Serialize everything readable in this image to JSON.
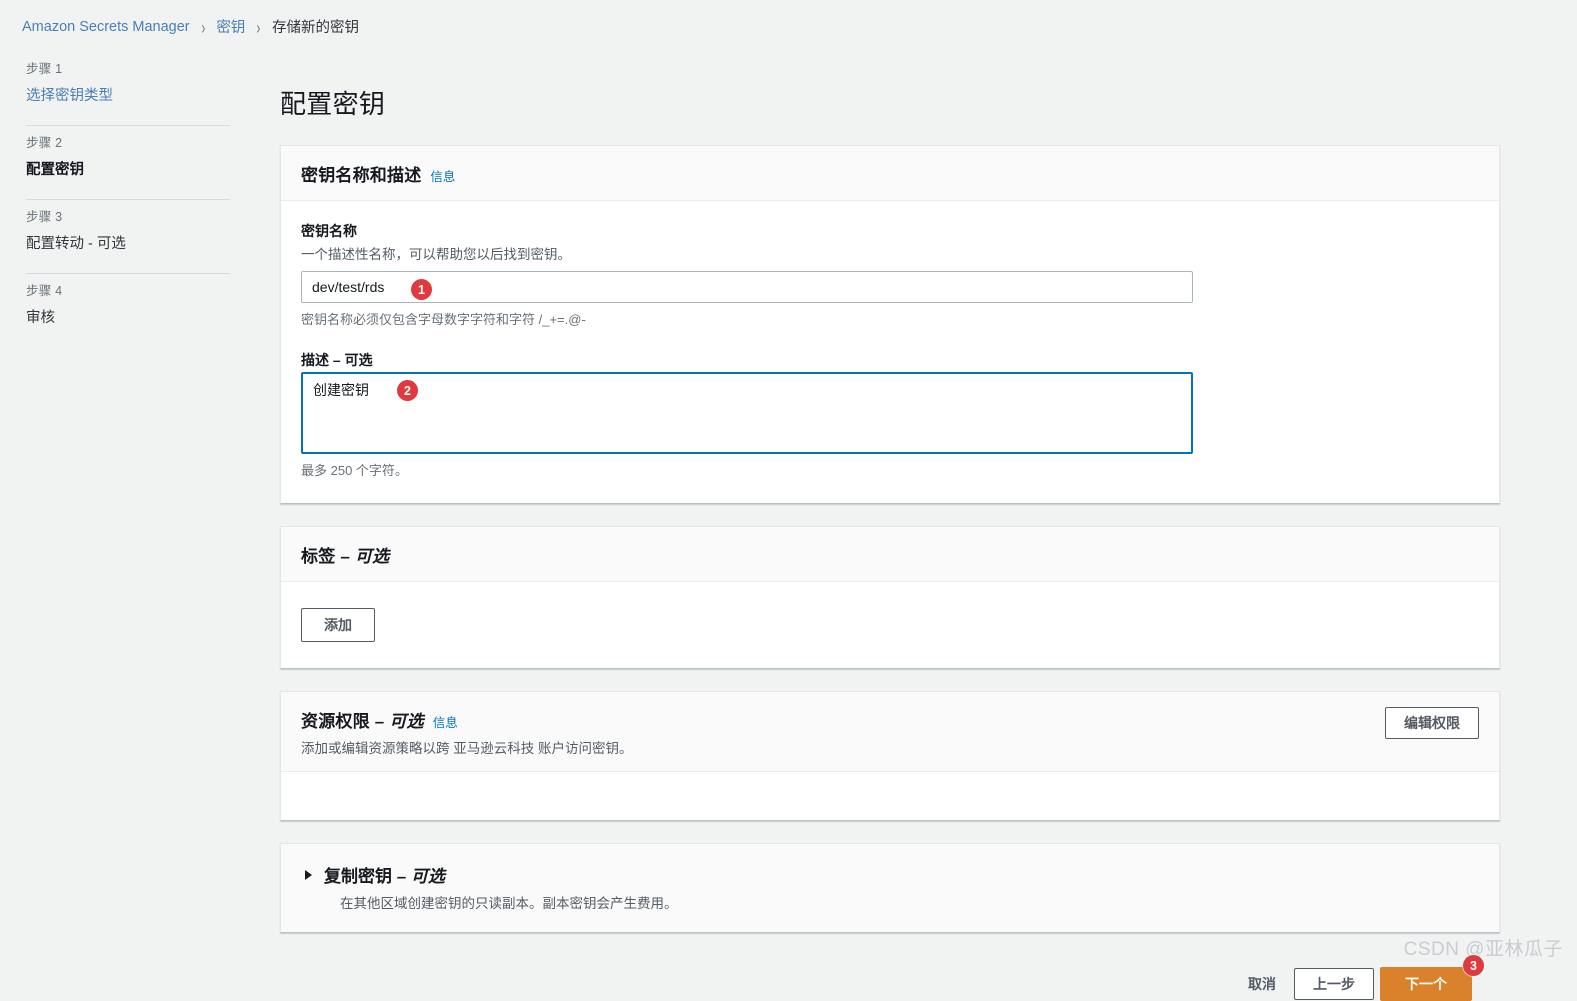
{
  "breadcrumb": {
    "items": [
      {
        "label": "Amazon Secrets Manager",
        "type": "link"
      },
      {
        "label": "密钥",
        "type": "link"
      },
      {
        "label": "存储新的密钥",
        "type": "current"
      }
    ],
    "separator": "›"
  },
  "wizard": {
    "steps": [
      {
        "number": "步骤 1",
        "title": "选择密钥类型",
        "state": "link"
      },
      {
        "number": "步骤 2",
        "title": "配置密钥",
        "state": "active"
      },
      {
        "number": "步骤 3",
        "title": "配置转动 - 可选",
        "state": "upcoming"
      },
      {
        "number": "步骤 4",
        "title": "审核",
        "state": "upcoming"
      }
    ]
  },
  "page": {
    "title": "配置密钥"
  },
  "secret_name_card": {
    "title": "密钥名称和描述",
    "info_label": "信息",
    "name_field": {
      "label": "密钥名称",
      "description": "一个描述性名称，可以帮助您以后找到密钥。",
      "value": "dev/test/rds",
      "placeholder": "",
      "hint": "密钥名称必须仅包含字母数字字符和字符 /_+=.@-"
    },
    "description_field": {
      "label": "描述 – 可选",
      "value": "创建密钥",
      "placeholder": "",
      "hint": "最多 250 个字符。"
    }
  },
  "tags_card": {
    "title_main": "标签",
    "title_optional": "– 可选",
    "add_button": "添加"
  },
  "permissions_card": {
    "title_main": "资源权限",
    "title_optional": "– 可选",
    "info_label": "信息",
    "subtitle": "添加或编辑资源策略以跨 亚马逊云科技 账户访问密钥。",
    "edit_button": "编辑权限"
  },
  "replicate_card": {
    "title_main": "复制密钥",
    "title_optional": "– 可选",
    "subtitle": "在其他区域创建密钥的只读副本。副本密钥会产生费用。",
    "expanded": false
  },
  "footer": {
    "cancel": "取消",
    "previous": "上一步",
    "next": "下一个"
  },
  "annotations": {
    "badge1": "1",
    "badge2": "2",
    "badge3": "3",
    "color": "#e0393e"
  },
  "watermark": {
    "text": "CSDN @亚林瓜子"
  }
}
